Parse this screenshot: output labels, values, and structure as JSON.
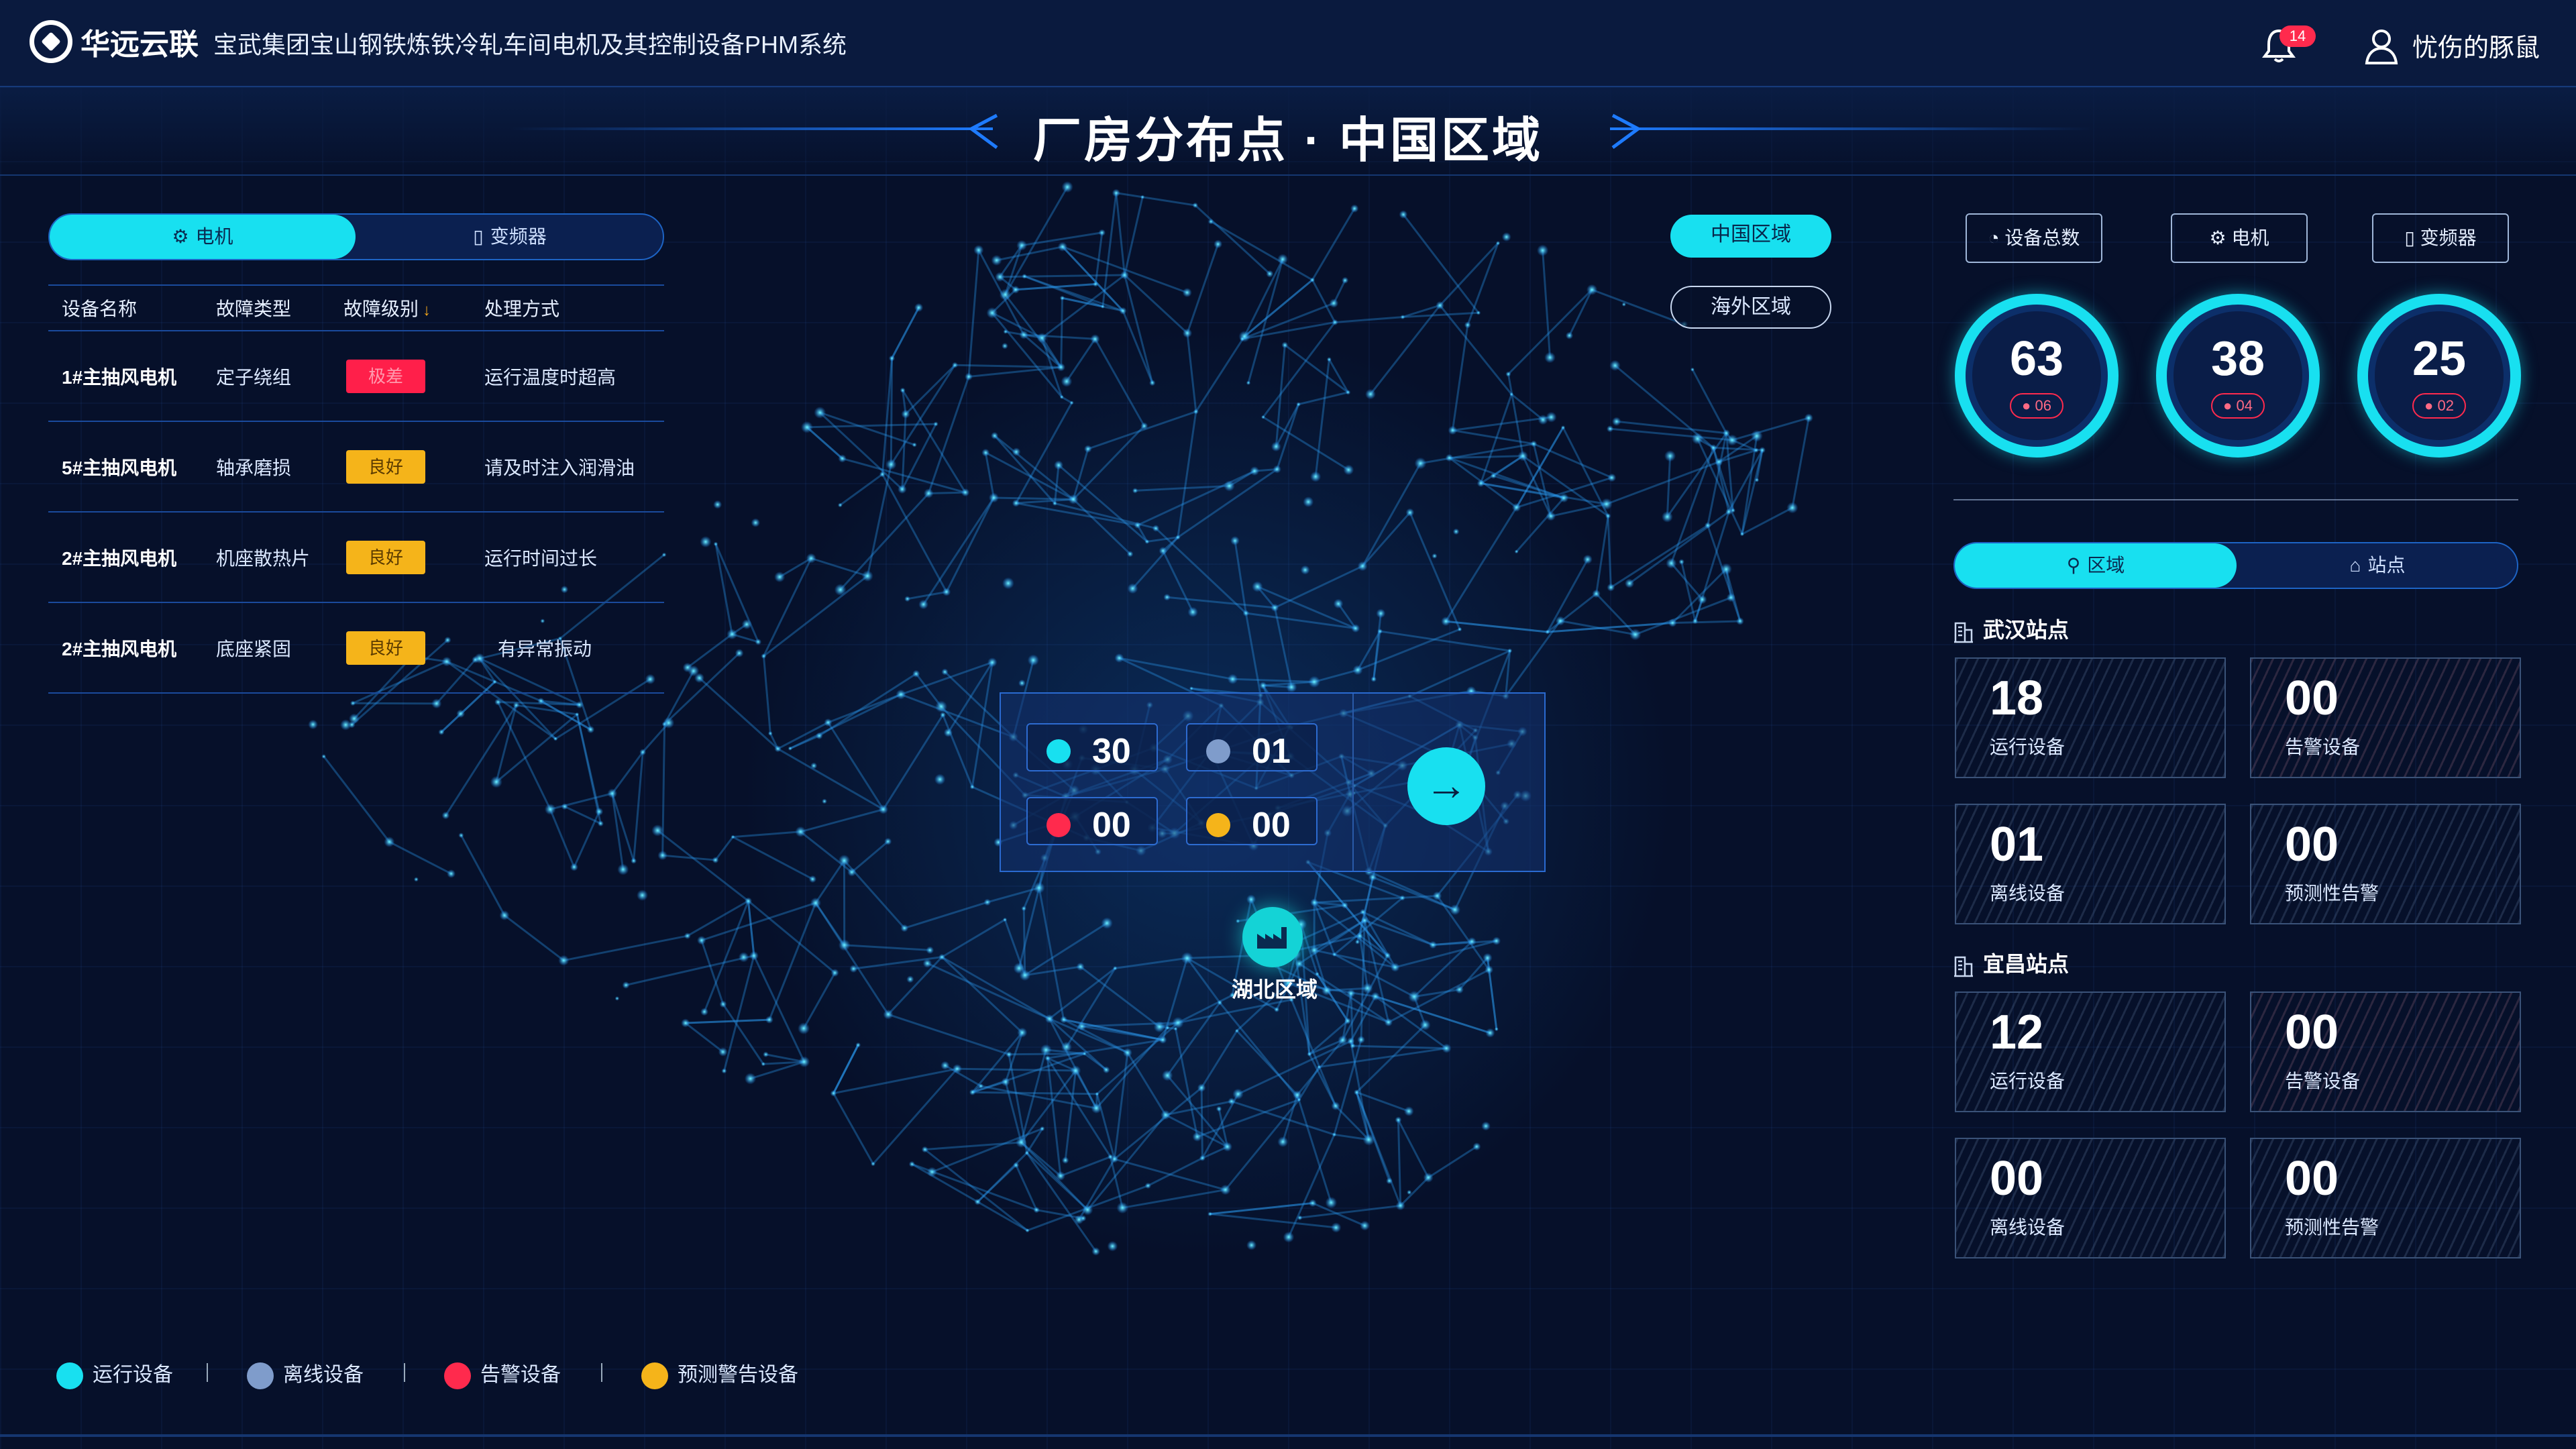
{
  "header": {
    "brand": "华远云联",
    "system_title": "宝武集团宝山钢铁炼铁冷轧车间电机及其控制设备PHM系统",
    "notification_count": "14",
    "user_name": "忧伤的豚鼠"
  },
  "page_title": "厂房分布点 · 中国区域",
  "left_tabs": [
    {
      "label": "电机",
      "icon": "gear-icon",
      "active": true
    },
    {
      "label": "变频器",
      "icon": "cabinet-icon",
      "active": false
    }
  ],
  "fault_table": {
    "headers": [
      "设备名称",
      "故障类型",
      "故障级别",
      "处理方式"
    ],
    "sort_icon": "sort-down-icon",
    "rows": [
      {
        "name": "1#主抽风电机",
        "type": "定子绕组",
        "level": "极差",
        "level_status": "bad",
        "action": "运行温度时超高"
      },
      {
        "name": "5#主抽风电机",
        "type": "轴承磨损",
        "level": "良好",
        "level_status": "good",
        "action": "请及时注入润滑油"
      },
      {
        "name": "2#主抽风电机",
        "type": "机座散热片",
        "level": "良好",
        "level_status": "good",
        "action": "运行时间过长"
      },
      {
        "name": "2#主抽风电机",
        "type": "底座紧固",
        "level": "良好",
        "level_status": "good",
        "action": "有异常振动"
      }
    ]
  },
  "region_buttons": {
    "china": "中国区域",
    "overseas": "海外区域"
  },
  "map_popup": {
    "running": "30",
    "offline": "01",
    "alarm": "00",
    "predictive": "00",
    "go_icon": "arrow-right-icon"
  },
  "map_marker": {
    "label": "湖北区域",
    "icon": "factory-icon"
  },
  "legend": [
    {
      "label": "运行设备",
      "color": "#18e0f0"
    },
    {
      "label": "离线设备",
      "color": "#7f9ccb"
    },
    {
      "label": "告警设备",
      "color": "#ff2a4d"
    },
    {
      "label": "预测警告设备",
      "color": "#f5b41a"
    }
  ],
  "stats": [
    {
      "label": "设备总数",
      "icon": "dashboard-icon",
      "value": "63",
      "alarm": "06"
    },
    {
      "label": "电机",
      "icon": "gear-icon",
      "value": "38",
      "alarm": "04"
    },
    {
      "label": "变频器",
      "icon": "cabinet-icon",
      "value": "25",
      "alarm": "02"
    }
  ],
  "right_tabs": [
    {
      "label": "区域",
      "icon": "region-icon",
      "active": true
    },
    {
      "label": "站点",
      "icon": "site-icon",
      "active": false
    }
  ],
  "stations": [
    {
      "name": "武汉站点",
      "cards": [
        {
          "value": "18",
          "label": "运行设备"
        },
        {
          "value": "00",
          "label": "告警设备"
        },
        {
          "value": "01",
          "label": "离线设备"
        },
        {
          "value": "00",
          "label": "预测性告警"
        }
      ]
    },
    {
      "name": "宜昌站点",
      "cards": [
        {
          "value": "12",
          "label": "运行设备"
        },
        {
          "value": "00",
          "label": "告警设备"
        },
        {
          "value": "00",
          "label": "离线设备"
        },
        {
          "value": "00",
          "label": "预测性告警"
        }
      ]
    }
  ],
  "colors": {
    "accent": "#18e0f0",
    "bad": "#ff1f4a",
    "good": "#f5b41a",
    "background": "#06102a"
  }
}
